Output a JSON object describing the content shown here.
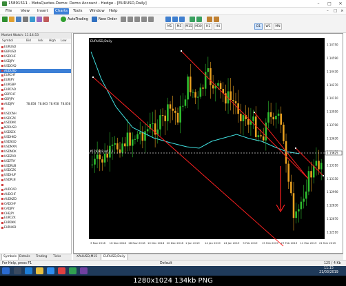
{
  "window": {
    "title": "15891511 - MetaQuotes-Demo: Demo Account - Hedge - [EURUSD,Daily]"
  },
  "menu": {
    "items": [
      "File",
      "View",
      "Insert",
      "Charts",
      "Tools",
      "Window",
      "Help"
    ],
    "active_index": 3
  },
  "toolbar": {
    "autotrading_label": "AutoTrading",
    "new_order_label": "New Order",
    "timeframes": [
      "M1",
      "M5",
      "M15",
      "M30",
      "H1",
      "H4",
      "D1",
      "W1",
      "MN"
    ],
    "active_timeframe": "D1"
  },
  "market_watch": {
    "title": "Market Watch: 11:14:53",
    "columns": [
      "Symbol",
      "Bid",
      "Ask",
      "High",
      "Low"
    ],
    "rows": [
      {
        "symbol": "EURUSD",
        "color": "#d04040"
      },
      {
        "symbol": "GBPUSD",
        "color": "#d04040"
      },
      {
        "symbol": "USDCHF",
        "color": "#d04040"
      },
      {
        "symbol": "USDJPY",
        "color": "#d04040"
      },
      {
        "symbol": "USDCAD",
        "color": "#d04040"
      },
      {
        "symbol": "AUDUSD",
        "color": "#d04040",
        "selected": true
      },
      {
        "symbol": "EURCHF",
        "color": "#d04040"
      },
      {
        "symbol": "EURJPY",
        "color": "#d04040"
      },
      {
        "symbol": "EURGBP",
        "color": "#d04040"
      },
      {
        "symbol": "EURCAD",
        "color": "#d04040"
      },
      {
        "symbol": "GBPCHF",
        "color": "#d04040"
      },
      {
        "symbol": "GBPJPY",
        "color": "#d04040"
      },
      {
        "symbol": "AUDJPY",
        "color": "#d04040",
        "bid": "78.858",
        "ask": "78.863",
        "high": "78.958",
        "low": "78.858"
      },
      {
        "symbol": "",
        "color": "#d04040"
      },
      {
        "symbol": "USDCNH",
        "color": "#d04040"
      },
      {
        "symbol": "USDCZK",
        "color": "#d04040"
      },
      {
        "symbol": "USDDKK",
        "color": "#d04040"
      },
      {
        "symbol": "NZDUSD",
        "color": "#d04040"
      },
      {
        "symbol": "USDSEK",
        "color": "#d04040"
      },
      {
        "symbol": "USDHKD",
        "color": "#d04040"
      },
      {
        "symbol": "USDSGD",
        "color": "#d04040"
      },
      {
        "symbol": "USDMXN",
        "color": "#d04040"
      },
      {
        "symbol": "USDNOK",
        "color": "#d04040"
      },
      {
        "symbol": "USDZAR",
        "color": "#d04040"
      },
      {
        "symbol": "USDTRY",
        "color": "#d04040"
      },
      {
        "symbol": "USDRUB",
        "color": "#d04040"
      },
      {
        "symbol": "USDCZK",
        "color": "#d04040"
      },
      {
        "symbol": "USDHUF",
        "color": "#d04040"
      },
      {
        "symbol": "USDPLN",
        "color": "#d04040"
      },
      {
        "symbol": "",
        "color": "#d04040"
      },
      {
        "symbol": "AUDCAD",
        "color": "#d04040"
      },
      {
        "symbol": "AUDCHF",
        "color": "#d04040"
      },
      {
        "symbol": "AUDNZD",
        "color": "#d04040"
      },
      {
        "symbol": "CADCHF",
        "color": "#d04040"
      },
      {
        "symbol": "CADJPY",
        "color": "#d04040"
      },
      {
        "symbol": "CHFJPY",
        "color": "#d04040"
      },
      {
        "symbol": "EURCZK",
        "color": "#d04040"
      },
      {
        "symbol": "EURDKK",
        "color": "#d04040"
      },
      {
        "symbol": "EURHKD",
        "color": "#d04040"
      }
    ],
    "tabs": [
      "Symbols",
      "Details",
      "Trading",
      "Ticks"
    ],
    "active_tab": 0
  },
  "chart": {
    "symbol_label": "EURUSD,Daily",
    "price_label": "#17918 B ref 2.1",
    "current_price": "1.13625",
    "y_ticks": [
      "1.14750",
      "1.14590",
      "1.14430",
      "1.14270",
      "1.14110",
      "1.13950",
      "1.13790",
      "1.13630",
      "1.13470",
      "1.13310",
      "1.13150",
      "1.12990",
      "1.12830",
      "1.12670",
      "1.12510"
    ],
    "x_ticks": [
      "3 Nov 2018",
      "16 Nov 2018",
      "28 Nov 2018",
      "10 Dec 2018",
      "20 Dec 2018",
      "2 Jan 2019",
      "14 Jan 2019",
      "24 Jan 2019",
      "5 Feb 2019",
      "15 Feb 2019",
      "27 Feb 2019",
      "11 Mar 2019",
      "21 Mar 2019"
    ],
    "colors": {
      "background": "#000000",
      "bull": "#2fbf2f",
      "bear": "#e8a020",
      "ma": "#40e0e0",
      "channel": "#ff2020",
      "dashed": "#d0d0d0"
    }
  },
  "chart_tabs": [
    "XAUUSD,M15",
    "EURUSD,Daily"
  ],
  "chart_tabs_active": 1,
  "status": {
    "help": "For Help, press F1",
    "profile": "Default",
    "traffic": "125 / 4 Kb"
  },
  "taskbar": {
    "clock_time": "11:15",
    "clock_date": "21/03/2019"
  },
  "info_bar": {
    "text": "1280x1024  134kb  PNG"
  }
}
